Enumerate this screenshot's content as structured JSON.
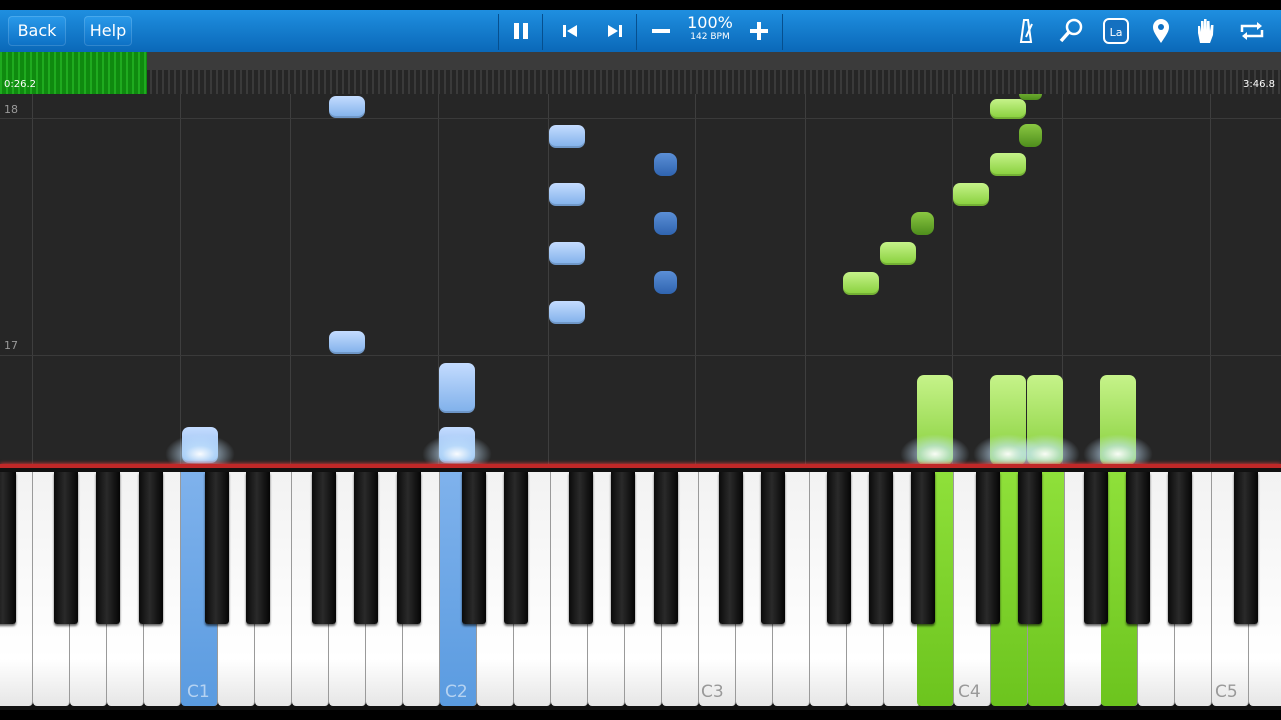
{
  "toolbar": {
    "back_label": "Back",
    "help_label": "Help",
    "speed_percent": "100%",
    "tempo": "142 BPM",
    "icons": [
      "pause-icon",
      "previous-icon",
      "next-icon",
      "minus-icon",
      "plus-icon",
      "metronome-icon",
      "zoom-icon",
      "note-labels-icon",
      "location-pin-icon",
      "hand-icon",
      "loop-icon"
    ],
    "note_labels_glyph": "La"
  },
  "timeline": {
    "current_time": "0:26.2",
    "total_time": "3:46.8",
    "progress_fraction": 0.115
  },
  "roll": {
    "measures": [
      "18",
      "17"
    ]
  },
  "keyboard": {
    "octave_labels": [
      "C1",
      "C2",
      "C3",
      "C4",
      "C5"
    ],
    "pressed_left_hand": [
      "C1",
      "C2"
    ],
    "pressed_right_hand": [
      "C4 area (4 keys)"
    ]
  },
  "colors": {
    "toolbar": "#0a68b8",
    "progress": "#1faa1f",
    "left_hand": "#7fb0ea",
    "right_hand": "#86cf3a",
    "hit_line": "#c02828"
  }
}
